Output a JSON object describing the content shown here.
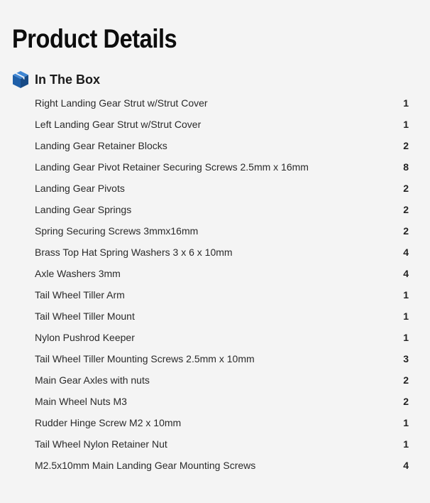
{
  "page": {
    "title": "Product Details"
  },
  "section": {
    "icon": "box-icon",
    "icon_color": "#1f5fa8",
    "title": "In The Box"
  },
  "items": [
    {
      "name": "Right Landing Gear Strut w/Strut Cover",
      "qty": "1"
    },
    {
      "name": "Left Landing Gear Strut w/Strut Cover",
      "qty": "1"
    },
    {
      "name": "Landing Gear Retainer Blocks",
      "qty": "2"
    },
    {
      "name": "Landing Gear Pivot Retainer Securing Screws 2.5mm x 16mm",
      "qty": "8"
    },
    {
      "name": "Landing Gear Pivots",
      "qty": "2"
    },
    {
      "name": "Landing Gear Springs",
      "qty": "2"
    },
    {
      "name": "Spring Securing Screws 3mmx16mm",
      "qty": "2"
    },
    {
      "name": "Brass Top Hat Spring Washers 3 x 6 x 10mm",
      "qty": "4"
    },
    {
      "name": "Axle Washers 3mm",
      "qty": "4"
    },
    {
      "name": "Tail Wheel Tiller Arm",
      "qty": "1"
    },
    {
      "name": "Tail Wheel Tiller Mount",
      "qty": "1"
    },
    {
      "name": "Nylon Pushrod Keeper",
      "qty": "1"
    },
    {
      "name": "Tail Wheel Tiller Mounting Screws 2.5mm x 10mm",
      "qty": "3"
    },
    {
      "name": "Main Gear Axles with nuts",
      "qty": "2"
    },
    {
      "name": "Main Wheel Nuts M3",
      "qty": "2"
    },
    {
      "name": "Rudder Hinge Screw M2 x 10mm",
      "qty": "1"
    },
    {
      "name": "Tail Wheel Nylon Retainer Nut",
      "qty": "1"
    },
    {
      "name": "M2.5x10mm Main Landing Gear Mounting Screws",
      "qty": "4"
    }
  ]
}
